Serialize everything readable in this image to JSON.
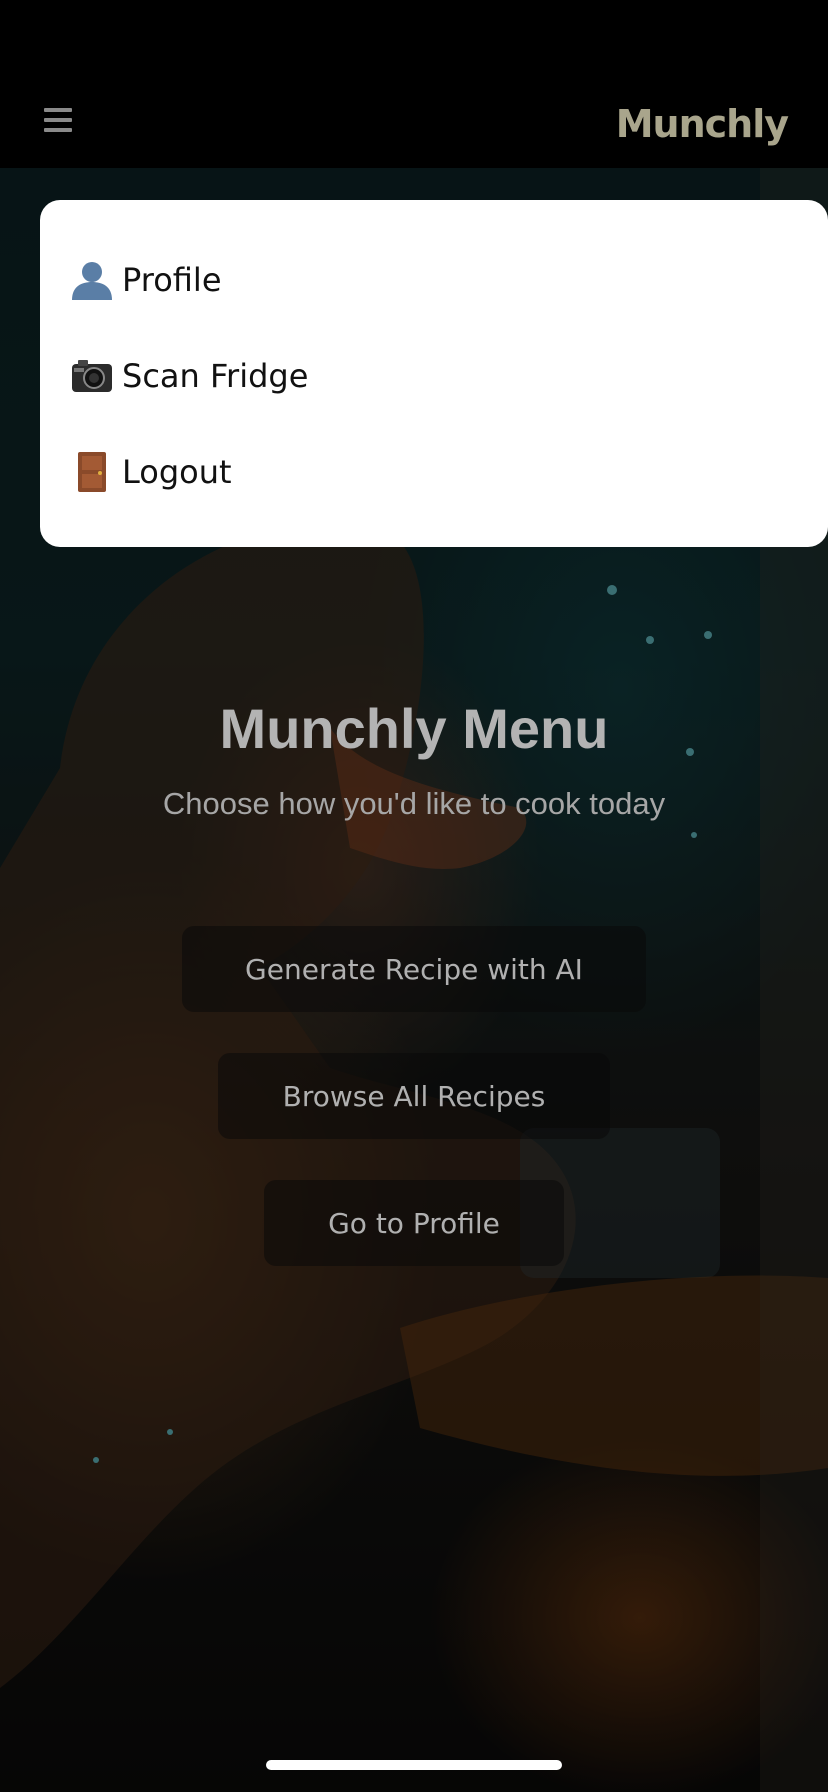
{
  "header": {
    "brand": "Munchly",
    "menu_icon": "hamburger-icon"
  },
  "dropdown": {
    "items": [
      {
        "icon": "user-silhouette-icon",
        "label": "Profile"
      },
      {
        "icon": "camera-icon",
        "label": "Scan Fridge"
      },
      {
        "icon": "door-icon",
        "label": "Logout"
      }
    ]
  },
  "main": {
    "title": "Munchly Menu",
    "subtitle": "Choose how you'd like to cook today",
    "buttons": [
      {
        "label": "Generate Recipe with AI"
      },
      {
        "label": "Browse All Recipes"
      },
      {
        "label": "Go to Profile"
      }
    ]
  },
  "colors": {
    "brand": "#a9a58c",
    "dropdown_bg": "#ffffff",
    "header_bg": "#000000"
  }
}
